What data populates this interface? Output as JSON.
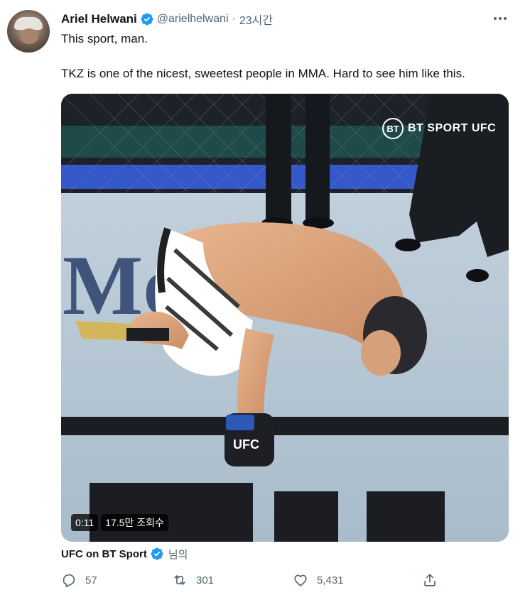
{
  "tweet": {
    "author_name": "Ariel Helwani",
    "handle": "@arielhelwani",
    "separator": "·",
    "time": "23시간",
    "text_line1": "This sport, man.",
    "text_line2": "TKZ is one of the nicest, sweetest people in MMA. Hard to see him like this."
  },
  "media": {
    "overlay_logo": "BT SPORT UFC",
    "duration": "0:11",
    "views": "17.5만 조회수"
  },
  "source": {
    "name": "UFC on BT Sport",
    "suffix": "님의"
  },
  "actions": {
    "reply_count": "57",
    "retweet_count": "301",
    "like_count": "5,431"
  },
  "icons": [
    "verified-icon",
    "more-icon",
    "reply-icon",
    "retweet-icon",
    "like-icon",
    "share-icon"
  ],
  "colors": {
    "accent": "#1d9bf0",
    "text": "#0f1419",
    "secondary": "#536471"
  }
}
